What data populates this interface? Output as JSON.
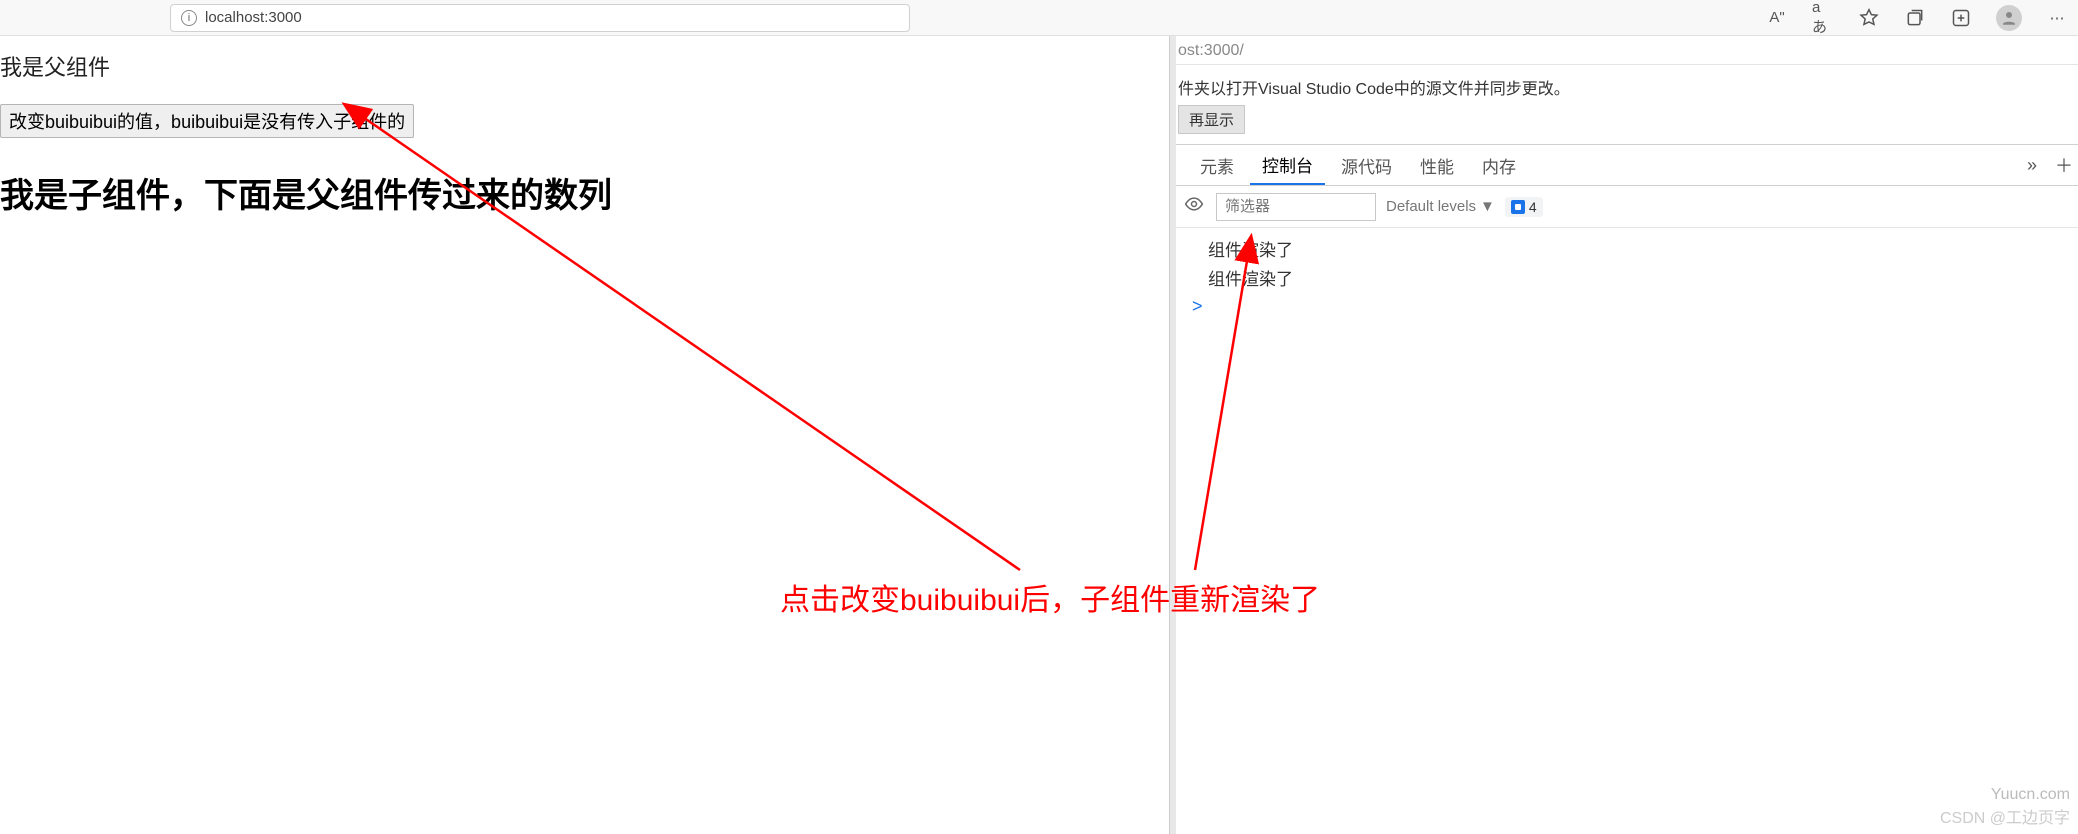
{
  "browser": {
    "url": "localhost:3000",
    "icons": {
      "readaloud": "A\"",
      "translate": "aあ",
      "favorites": "☆",
      "collections": "⧉",
      "addtab": "⊕",
      "menu": "⋯"
    }
  },
  "page": {
    "parent_text": "我是父组件",
    "button_label": "改变buibuibui的值，buibuibui是没有传入子组件的",
    "child_heading": "我是子组件，下面是父组件传过来的数列"
  },
  "devtools": {
    "url_partial": "ost:3000/",
    "vscode_hint": "件夹以打开Visual Studio Code中的源文件并同步更改。",
    "hint_button": "再显示",
    "tabs": [
      "元素",
      "控制台",
      "源代码",
      "性能",
      "内存"
    ],
    "active_tab": "控制台",
    "filter_placeholder": "筛选器",
    "levels_label": "Default levels",
    "issue_count": "4",
    "logs": [
      "组件渲染了",
      "组件渲染了"
    ],
    "prompt": ">"
  },
  "annotation": {
    "text": "点击改变buibuibui后，子组件重新渲染了"
  },
  "watermarks": {
    "yuu": "Yuucn.com",
    "csdn": "CSDN @工边页字"
  }
}
